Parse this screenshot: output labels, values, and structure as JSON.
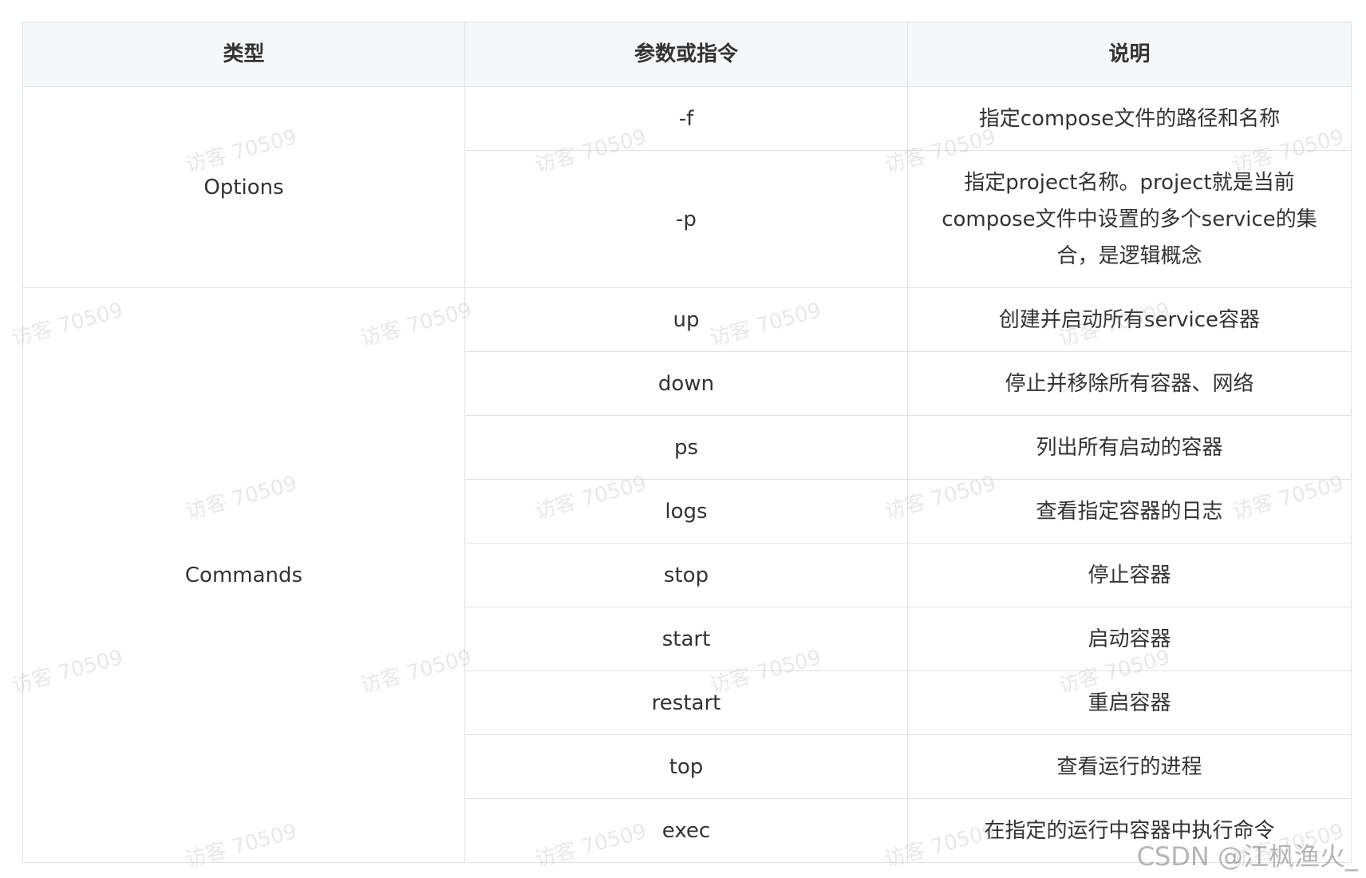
{
  "table": {
    "headers": [
      "类型",
      "参数或指令",
      "说明"
    ],
    "groups": [
      {
        "type": "Options",
        "rows": [
          {
            "param": "-f",
            "desc": "指定compose文件的路径和名称"
          },
          {
            "param": "-p",
            "desc": "指定project名称。project就是当前compose文件中设置的多个service的集合，是逻辑概念"
          }
        ]
      },
      {
        "type": "Commands",
        "rows": [
          {
            "param": "up",
            "desc": "创建并启动所有service容器"
          },
          {
            "param": "down",
            "desc": "停止并移除所有容器、网络"
          },
          {
            "param": "ps",
            "desc": "列出所有启动的容器"
          },
          {
            "param": "logs",
            "desc": "查看指定容器的日志"
          },
          {
            "param": "stop",
            "desc": "停止容器"
          },
          {
            "param": "start",
            "desc": "启动容器"
          },
          {
            "param": "restart",
            "desc": "重启容器"
          },
          {
            "param": "top",
            "desc": "查看运行的进程"
          },
          {
            "param": "exec",
            "desc": "在指定的运行中容器中执行命令"
          }
        ]
      }
    ]
  },
  "watermark": {
    "text": "访客 70509",
    "credit": "CSDN @江枫渔火_"
  }
}
